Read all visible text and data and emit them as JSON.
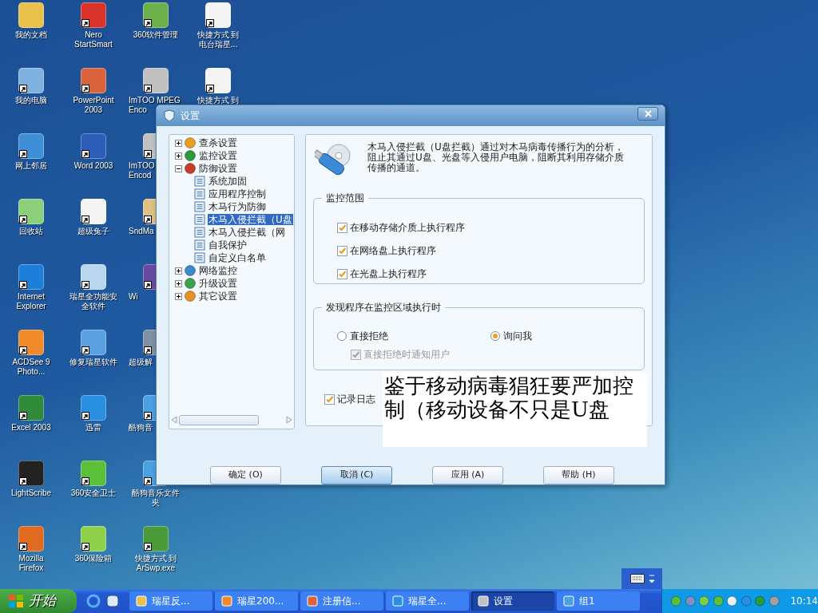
{
  "desktop_icons": [
    {
      "label": "我的文档"
    },
    {
      "label": "我的电脑"
    },
    {
      "label": "网上邻居"
    },
    {
      "label": "回收站"
    },
    {
      "label": "Internet\nExplorer"
    },
    {
      "label": "ACDSee 9\nPhoto..."
    },
    {
      "label": "Excel 2003"
    },
    {
      "label": "LightScribe"
    },
    {
      "label": "Mozilla\nFirefox"
    },
    {
      "label": "Nero\nStartSmart"
    },
    {
      "label": "PowerPoint\n2003"
    },
    {
      "label": "Word 2003"
    },
    {
      "label": "超级兔子"
    },
    {
      "label": "瑞星全功能安全软件"
    },
    {
      "label": "修复瑞星软件"
    },
    {
      "label": "迅雷"
    },
    {
      "label": "360安全卫士"
    },
    {
      "label": "360保险箱"
    },
    {
      "label": "360软件管理"
    },
    {
      "label": "ImTOO MPEG\nEnco"
    },
    {
      "label": "ImTOO\nEncod"
    },
    {
      "label": "SndMa"
    },
    {
      "label": "Wi"
    },
    {
      "label": "超级解"
    },
    {
      "label": "酷狗音"
    },
    {
      "label": "酷狗音乐文件夹"
    },
    {
      "label": "快捷方式 到\nArSwp.exe"
    },
    {
      "label": "快捷方式 到电台瑞星..."
    },
    {
      "label": "快捷方式 到"
    }
  ],
  "dialog": {
    "title": "设置",
    "tree": [
      {
        "label": "查杀设置",
        "expanded": false,
        "selected": false
      },
      {
        "label": "监控设置",
        "expanded": false,
        "selected": false
      },
      {
        "label": "防御设置",
        "expanded": true,
        "selected": false,
        "children": [
          {
            "label": "系统加固",
            "selected": false
          },
          {
            "label": "应用程序控制",
            "selected": false
          },
          {
            "label": "木马行为防御",
            "selected": false
          },
          {
            "label": "木马入侵拦截（U盘",
            "selected": true
          },
          {
            "label": "木马入侵拦截（网",
            "selected": false
          },
          {
            "label": "自我保护",
            "selected": false
          },
          {
            "label": "自定义白名单",
            "selected": false
          }
        ]
      },
      {
        "label": "网络监控",
        "expanded": false,
        "selected": false
      },
      {
        "label": "升级设置",
        "expanded": false,
        "selected": false
      },
      {
        "label": "其它设置",
        "expanded": false,
        "selected": false
      }
    ],
    "description": "木马入侵拦截（U盘拦截）通过对木马病毒传播行为的分析，阻止其通过U盘、光盘等入侵用户电脑，阻断其利用存储介质传播的通道。",
    "scope_group": {
      "title": "监控范围",
      "options": [
        {
          "label": "在移动存储介质上执行程序",
          "checked": true
        },
        {
          "label": "在网络盘上执行程序",
          "checked": true
        },
        {
          "label": "在光盘上执行程序",
          "checked": true
        }
      ]
    },
    "action_group": {
      "title": "发现程序在监控区域执行时",
      "radios": [
        {
          "label": "直接拒绝",
          "selected": false
        },
        {
          "label": "询问我",
          "selected": true
        }
      ],
      "notify": {
        "label": "直接拒绝时通知用户",
        "checked": true,
        "disabled": true
      }
    },
    "log": {
      "label": "记录日志",
      "checked": true
    },
    "buttons": [
      {
        "label": "确定 (O)",
        "selected": false
      },
      {
        "label": "取消 (C)",
        "selected": true
      },
      {
        "label": "应用 (A)",
        "selected": false
      },
      {
        "label": "帮助 (H)",
        "selected": false
      }
    ]
  },
  "note": "鉴于移动病毒猖狂要严加控制（移动设备不只是U盘",
  "taskbar": {
    "start": "开始",
    "tasks": [
      {
        "label": "瑞星反...",
        "selected": false
      },
      {
        "label": "瑞星200...",
        "selected": false
      },
      {
        "label": "注册信...",
        "selected": false
      },
      {
        "label": "瑞星全...",
        "selected": false
      },
      {
        "label": "设置",
        "selected": true
      },
      {
        "label": "组1",
        "selected": false
      }
    ],
    "clock": "10:14"
  }
}
